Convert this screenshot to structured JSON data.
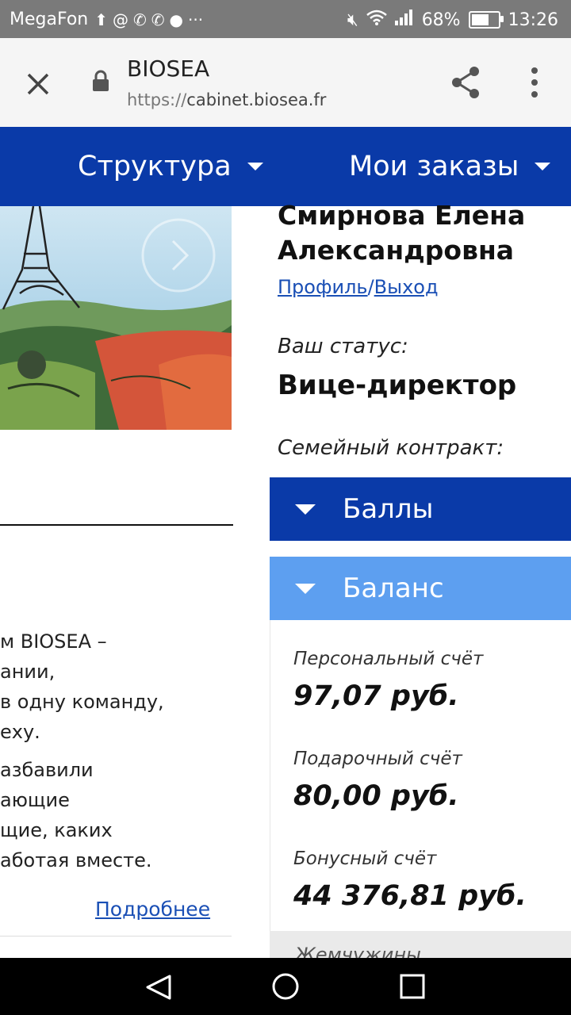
{
  "status_bar": {
    "carrier": "MegaFon",
    "battery_percent": "68%",
    "battery_level": 0.68,
    "time": "13:26"
  },
  "browser": {
    "page_title": "BIOSEA",
    "url_scheme": "https://",
    "url_host": "cabinet.biosea.fr"
  },
  "nav": {
    "items": [
      {
        "label": "Структура"
      },
      {
        "label": "Мои заказы"
      }
    ]
  },
  "left": {
    "lines": [
      "м BIOSEA –",
      "ании,",
      "в одну команду,",
      "еху."
    ],
    "lines2": [
      "азбавили",
      "ающие",
      "щие, каких",
      "аботая вместе."
    ],
    "more_link": "Подробнее"
  },
  "profile": {
    "name_line1": "Смирнова Елена",
    "name_line2": "Александровна",
    "profile_link": "Профиль",
    "separator": "/",
    "logout_link": "Выход",
    "status_label": "Ваш статус:",
    "status_value": "Вице-директор",
    "contract_label": "Семейный контракт:"
  },
  "accordion": {
    "points_label": "Баллы",
    "balance_label": "Баланс"
  },
  "balance": {
    "personal_label": "Персональный счёт",
    "personal_value": "97,07 руб.",
    "gift_label": "Подарочный счёт",
    "gift_value": "80,00 руб.",
    "bonus_label": "Бонусный счёт",
    "bonus_value": "44 376,81 руб.",
    "pearls_label": "Жемчужины"
  },
  "colors": {
    "nav_blue": "#0a3aa8",
    "accordion_light": "#5d9ff0",
    "link": "#1a4fb5"
  }
}
